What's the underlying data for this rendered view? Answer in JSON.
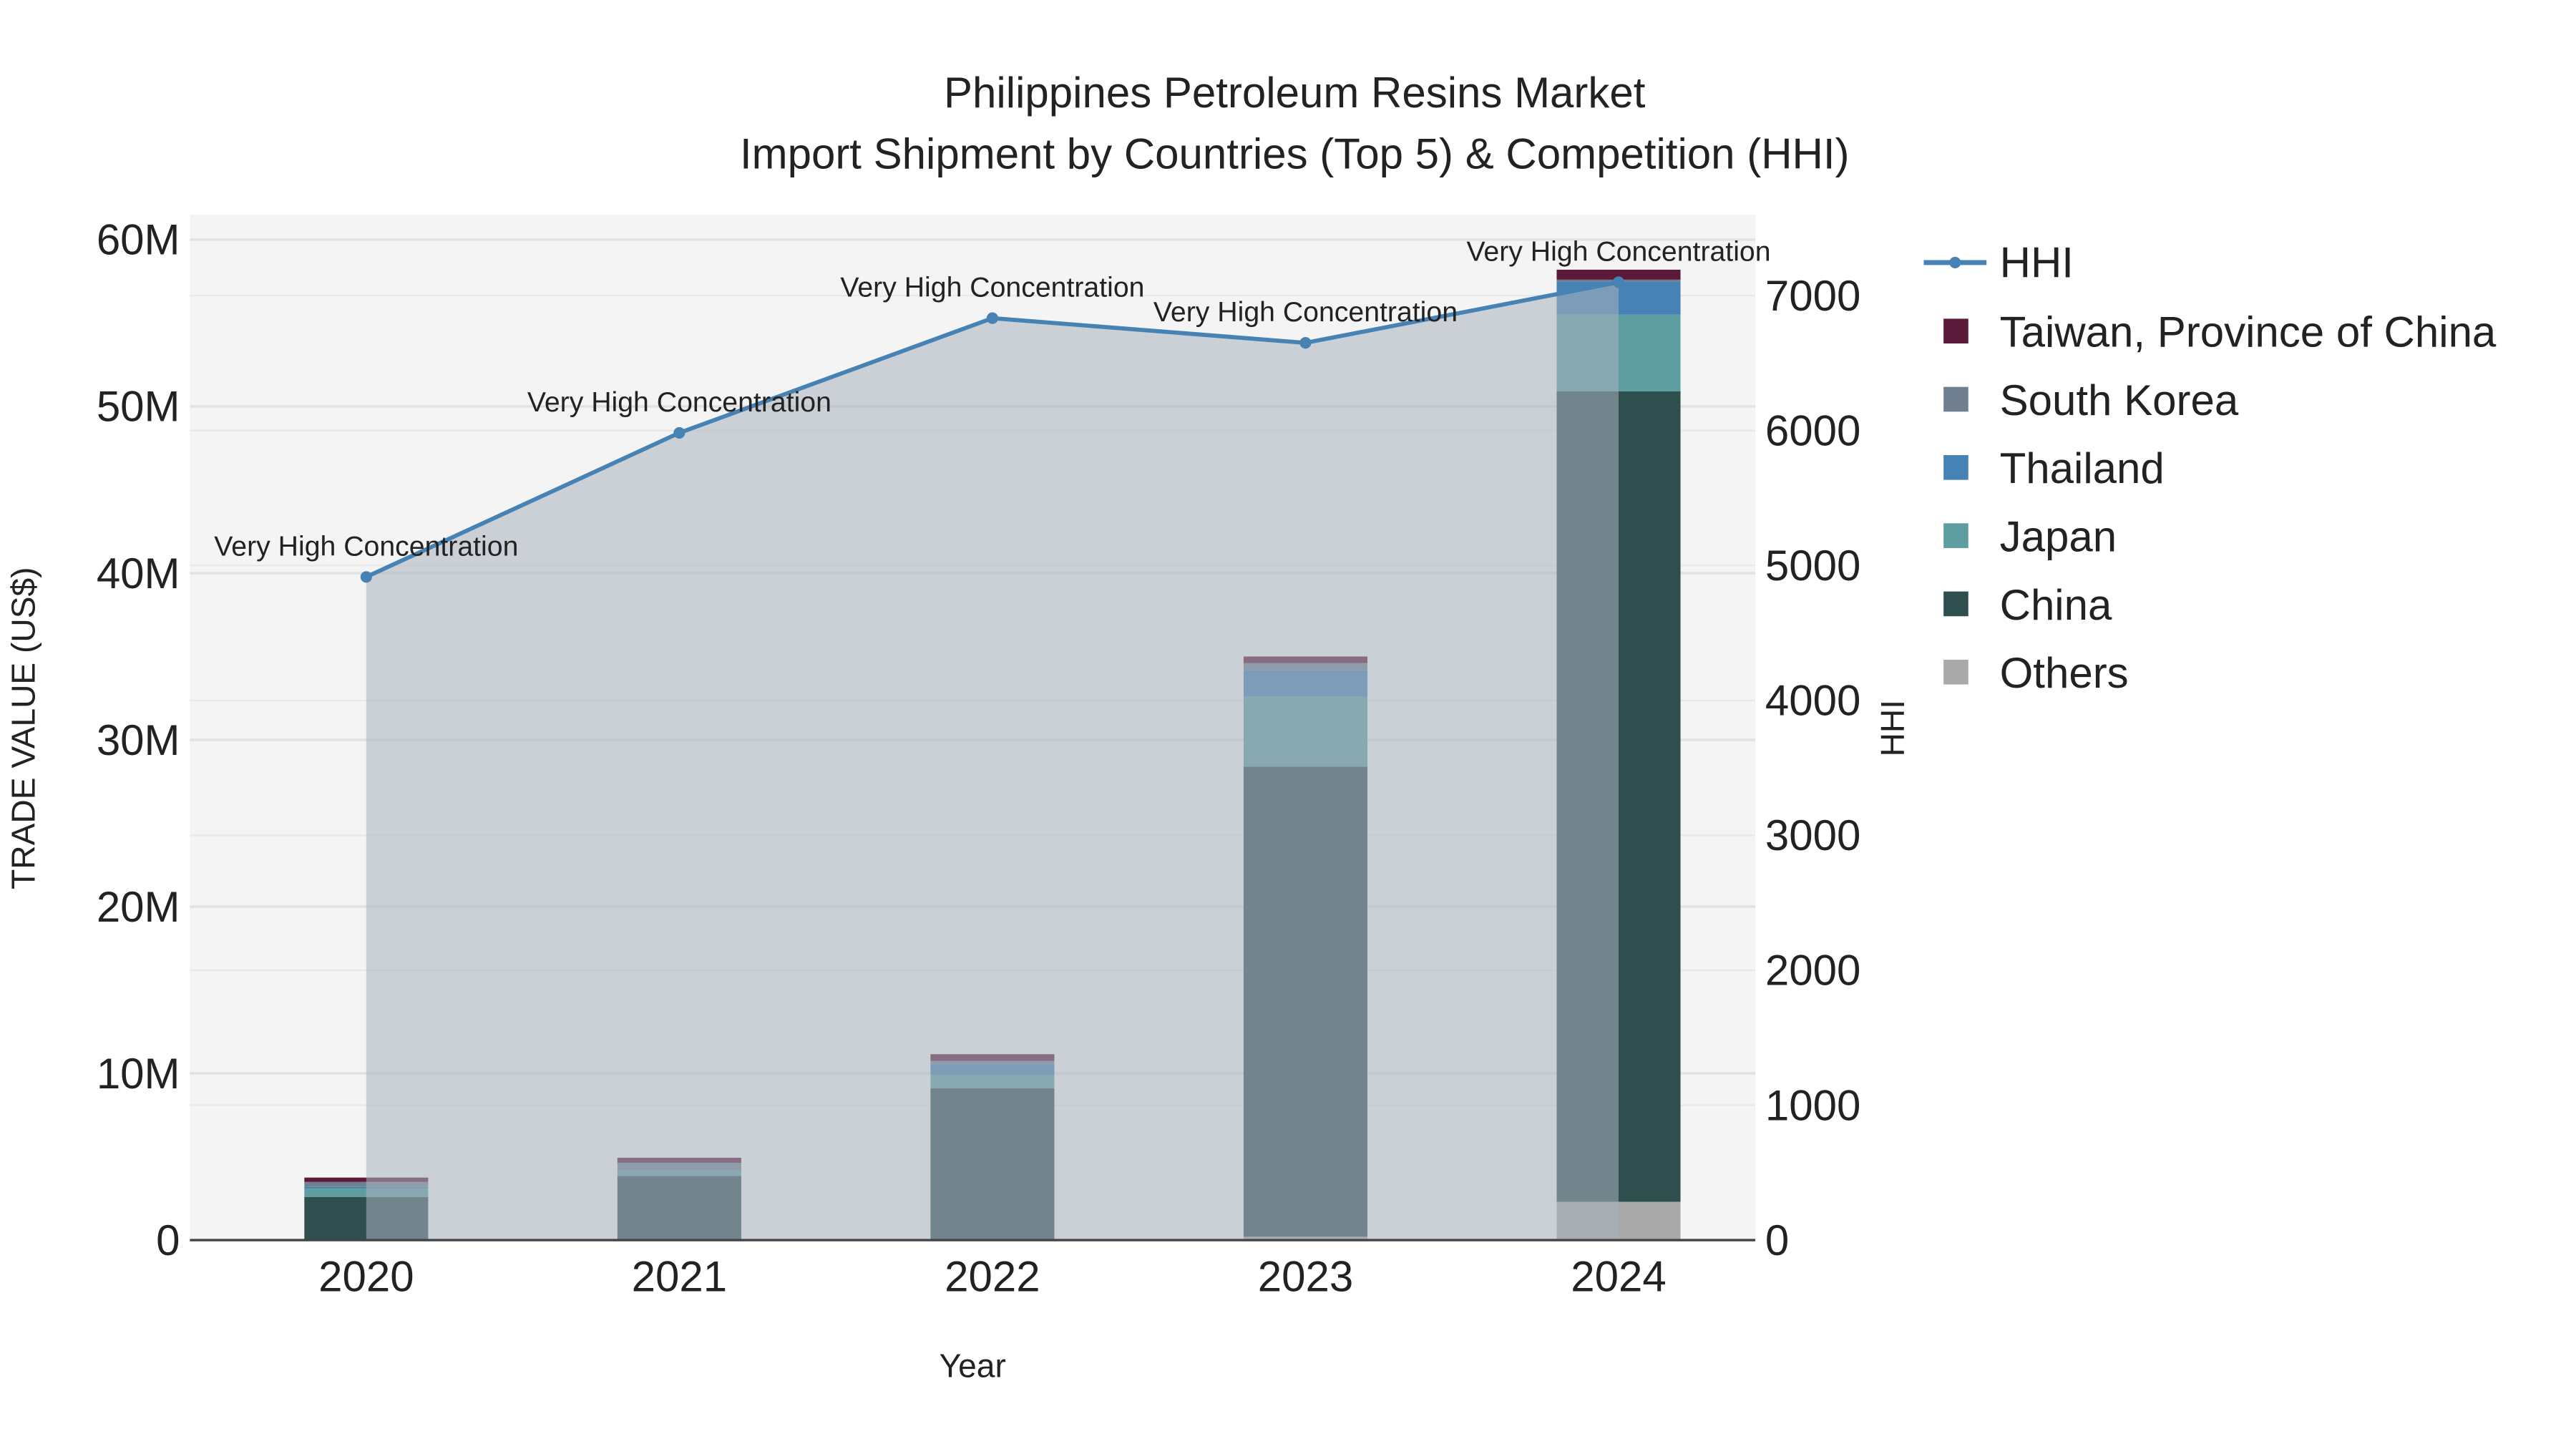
{
  "chart_data": {
    "type": "bar",
    "title": "Philippines Petroleum Resins Market",
    "subtitle": "Import Shipment by Countries (Top 5) & Competition (HHI)",
    "xlabel": "Year",
    "ylabel": "TRADE VALUE (US$)",
    "y2label": "HHI",
    "categories": [
      "2020",
      "2021",
      "2022",
      "2023",
      "2024"
    ],
    "ylim": [
      0,
      61500000
    ],
    "y_ticks": [
      0,
      10000000,
      20000000,
      30000000,
      40000000,
      50000000,
      60000000
    ],
    "y_tick_labels": [
      "0",
      "10M",
      "20M",
      "30M",
      "40M",
      "50M",
      "60M"
    ],
    "y2lim": [
      0,
      7600
    ],
    "y2_ticks": [
      0,
      1000,
      2000,
      3000,
      4000,
      5000,
      6000,
      7000
    ],
    "y2_tick_labels": [
      "0",
      "1000",
      "2000",
      "3000",
      "4000",
      "5000",
      "6000",
      "7000"
    ],
    "grid": true,
    "legend_placement": "right",
    "series": [
      {
        "name": "Others",
        "color": "#a9a9a9",
        "values": [
          20000,
          50000,
          30000,
          200000,
          2300000
        ]
      },
      {
        "name": "China",
        "color": "#2f4f4f",
        "values": [
          2570000,
          3800000,
          9070000,
          28200000,
          48600000
        ]
      },
      {
        "name": "Japan",
        "color": "#5f9ea0",
        "values": [
          500000,
          300000,
          800000,
          4200000,
          4600000
        ]
      },
      {
        "name": "Thailand",
        "color": "#4682b4",
        "values": [
          100000,
          20000,
          650000,
          1600000,
          2000000
        ]
      },
      {
        "name": "South Korea",
        "color": "#708090",
        "values": [
          300000,
          470000,
          200000,
          400000,
          100000
        ]
      },
      {
        "name": "Taiwan, Province of China",
        "color": "#5c1a3a",
        "values": [
          260000,
          300000,
          400000,
          400000,
          600000
        ]
      }
    ],
    "line": {
      "name": "HHI",
      "color": "#4682b4",
      "values": [
        4915,
        5983,
        6833,
        6650,
        7100
      ],
      "annotations": [
        "Very High Concentration",
        "Very High Concentration",
        "Very High Concentration",
        "Very High Concentration",
        "Very High Concentration"
      ]
    },
    "legend_order": [
      "HHI",
      "Taiwan, Province of China",
      "South Korea",
      "Thailand",
      "Japan",
      "China",
      "Others"
    ]
  }
}
